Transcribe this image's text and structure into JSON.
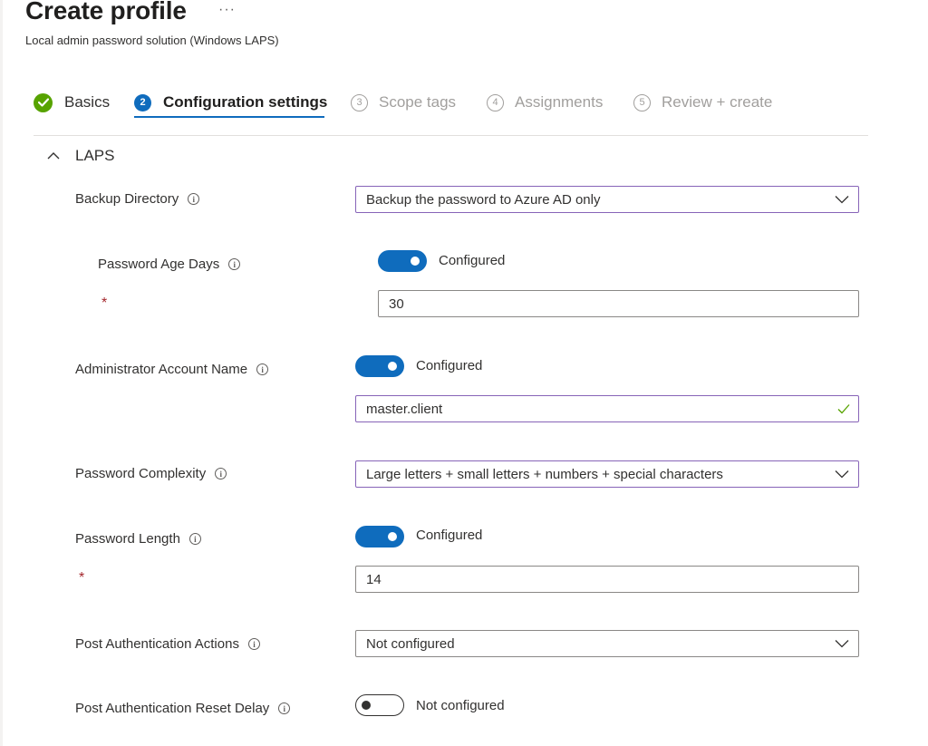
{
  "header": {
    "title": "Create profile",
    "more_label": "···",
    "subtitle": "Local admin password solution (Windows LAPS)"
  },
  "steps": [
    {
      "label": "Basics",
      "state": "done"
    },
    {
      "number": "2",
      "label": "Configuration settings",
      "state": "active"
    },
    {
      "number": "3",
      "label": "Scope tags",
      "state": "disabled"
    },
    {
      "number": "4",
      "label": "Assignments",
      "state": "disabled"
    },
    {
      "number": "5",
      "label": "Review + create",
      "state": "disabled"
    }
  ],
  "section": {
    "title": "LAPS",
    "expanded": true
  },
  "info_glyph": "i",
  "required_mark": "*",
  "settings": {
    "backup_directory": {
      "label": "Backup Directory",
      "value": "Backup the password to Azure AD only"
    },
    "password_age_days": {
      "label": "Password Age Days",
      "toggle_on": true,
      "toggle_text": "Configured",
      "value": "30"
    },
    "admin_account_name": {
      "label": "Administrator Account Name",
      "toggle_on": true,
      "toggle_text": "Configured",
      "value": "master.client"
    },
    "password_complexity": {
      "label": "Password Complexity",
      "value": "Large letters + small letters + numbers + special characters"
    },
    "password_length": {
      "label": "Password Length",
      "toggle_on": true,
      "toggle_text": "Configured",
      "value": "14"
    },
    "post_auth_actions": {
      "label": "Post Authentication Actions",
      "value": "Not configured"
    },
    "post_auth_reset_delay": {
      "label": "Post Authentication Reset Delay",
      "toggle_on": false,
      "toggle_text": "Not configured"
    }
  },
  "colors": {
    "accent": "#0f6cbd",
    "success": "#57a300",
    "focus_border": "#8764b8",
    "required": "#a4262c"
  }
}
